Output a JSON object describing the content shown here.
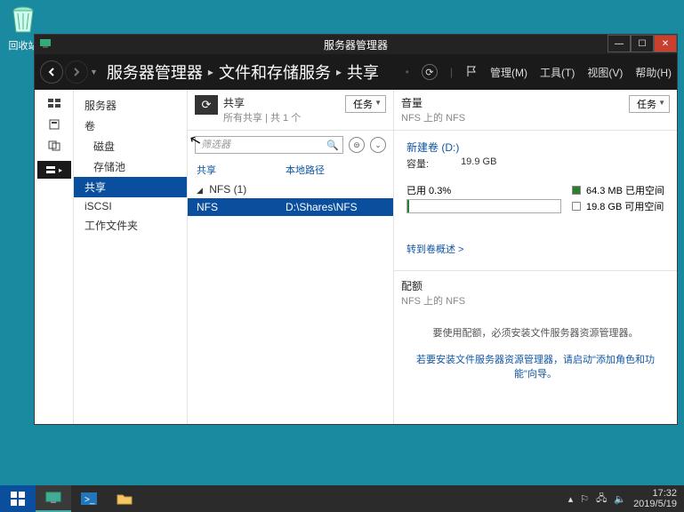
{
  "desktop": {
    "recycle_bin": "回收站"
  },
  "window": {
    "title": "服务器管理器",
    "breadcrumb": [
      "服务器管理器",
      "文件和存储服务",
      "共享"
    ],
    "menu": {
      "manage": "管理(M)",
      "tools": "工具(T)",
      "view": "视图(V)",
      "help": "帮助(H)"
    }
  },
  "sidebar": {
    "items": [
      {
        "label": "服务器"
      },
      {
        "label": "卷"
      },
      {
        "label": "磁盘"
      },
      {
        "label": "存储池"
      },
      {
        "label": "共享",
        "selected": true
      },
      {
        "label": "iSCSI"
      },
      {
        "label": "工作文件夹"
      }
    ]
  },
  "shares": {
    "title": "共享",
    "subtitle": "所有共享 | 共 1 个",
    "task_label": "任务",
    "filter_placeholder": "筛选器",
    "col_share": "共享",
    "col_path": "本地路径",
    "group": "NFS (1)",
    "rows": [
      {
        "name": "NFS",
        "path": "D:\\Shares\\NFS",
        "selected": true
      }
    ]
  },
  "volume": {
    "title": "音量",
    "subtitle": "NFS 上的 NFS",
    "task_label": "任务",
    "vol_name": "新建卷 (D:)",
    "cap_label": "容量:",
    "cap_value": "19.9 GB",
    "used_label": "已用 0.3%",
    "legend_used": "64.3 MB 已用空间",
    "legend_free": "19.8 GB 可用空间",
    "link": "转到卷概述 >"
  },
  "quota": {
    "title": "配额",
    "subtitle": "NFS 上的 NFS",
    "msg1": "要使用配额，必须安装文件服务器资源管理器。",
    "msg2": "若要安装文件服务器资源管理器，请启动\"添加角色和功能\"向导。"
  },
  "taskbar": {
    "time": "17:32",
    "date": "2019/5/19"
  }
}
